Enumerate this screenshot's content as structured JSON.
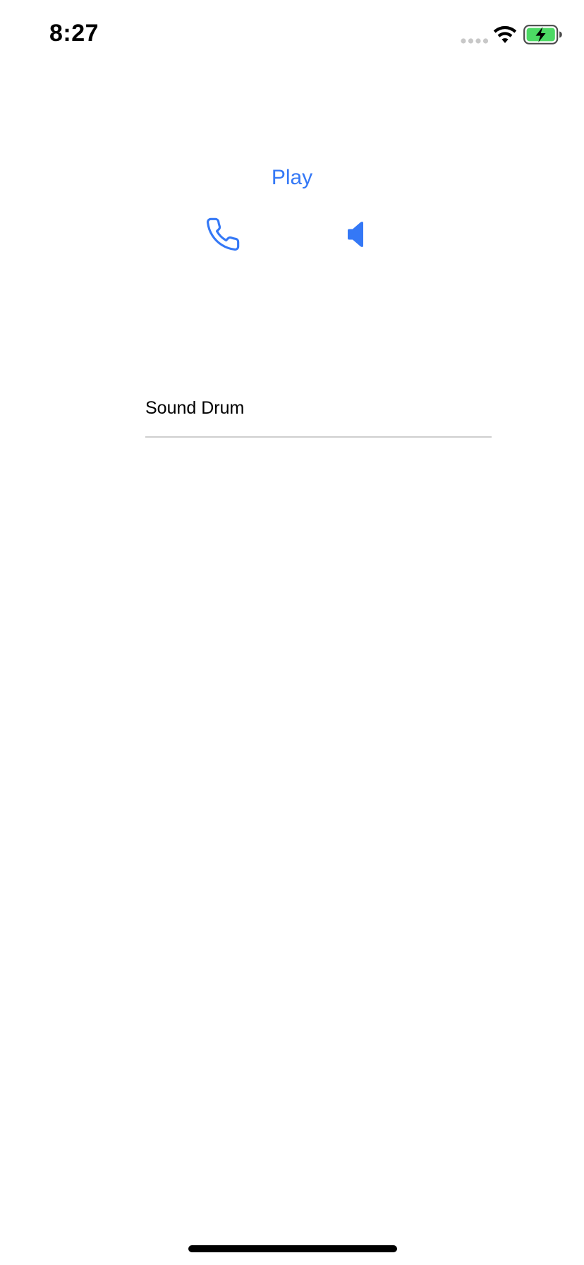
{
  "status_bar": {
    "time": "8:27",
    "icons": [
      "cellular-signal-icon",
      "wifi-icon",
      "battery-charging-icon"
    ]
  },
  "main": {
    "play_label": "Play",
    "phone_icon": "phone-icon",
    "speaker_icon": "speaker-icon",
    "sound_field_value": "Sound Drum"
  },
  "colors": {
    "accent": "#3478f6",
    "battery_fill": "#4cd964",
    "divider": "#cfcfcf"
  }
}
